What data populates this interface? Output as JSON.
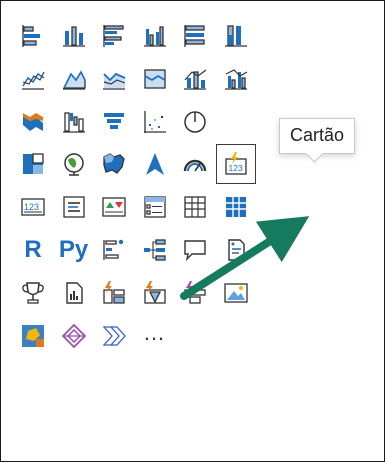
{
  "tooltip": {
    "text": "Cartão"
  },
  "text_icons": {
    "r": "R",
    "py": "Py",
    "more": "..."
  },
  "colors": {
    "blue": "#1f6fbf",
    "light_blue": "#8ab6e6",
    "yellow": "#f2b705",
    "orange": "#e07a1f",
    "purple": "#9b4fb0",
    "arrow": "#157a5e"
  },
  "visuals": [
    {
      "row": 0,
      "col": 0,
      "icon": "stacked-bar-chart-icon",
      "selected": false
    },
    {
      "row": 0,
      "col": 1,
      "icon": "stacked-column-chart-icon",
      "selected": false
    },
    {
      "row": 0,
      "col": 2,
      "icon": "clustered-bar-chart-icon",
      "selected": false
    },
    {
      "row": 0,
      "col": 3,
      "icon": "clustered-column-chart-icon",
      "selected": false
    },
    {
      "row": 0,
      "col": 4,
      "icon": "100-stacked-bar-chart-icon",
      "selected": false
    },
    {
      "row": 0,
      "col": 5,
      "icon": "100-stacked-column-chart-icon",
      "selected": false
    },
    {
      "row": 1,
      "col": 0,
      "icon": "line-chart-icon",
      "selected": false
    },
    {
      "row": 1,
      "col": 1,
      "icon": "area-chart-icon",
      "selected": false
    },
    {
      "row": 1,
      "col": 2,
      "icon": "stacked-area-chart-icon",
      "selected": false
    },
    {
      "row": 1,
      "col": 3,
      "icon": "100-stacked-area-chart-icon",
      "selected": false
    },
    {
      "row": 1,
      "col": 4,
      "icon": "line-and-column-chart-icon",
      "selected": false
    },
    {
      "row": 1,
      "col": 5,
      "icon": "line-and-clustered-column-chart-icon",
      "selected": false
    },
    {
      "row": 2,
      "col": 0,
      "icon": "ribbon-chart-icon",
      "selected": false
    },
    {
      "row": 2,
      "col": 1,
      "icon": "waterfall-chart-icon",
      "selected": false
    },
    {
      "row": 2,
      "col": 2,
      "icon": "funnel-chart-icon",
      "selected": false
    },
    {
      "row": 2,
      "col": 3,
      "icon": "scatter-chart-icon",
      "selected": false
    },
    {
      "row": 2,
      "col": 4,
      "icon": "pie-chart-icon",
      "selected": false
    },
    {
      "row": 3,
      "col": 0,
      "icon": "treemap-icon",
      "selected": false
    },
    {
      "row": 3,
      "col": 1,
      "icon": "globe-map-icon",
      "selected": false
    },
    {
      "row": 3,
      "col": 2,
      "icon": "filled-map-icon",
      "selected": false
    },
    {
      "row": 3,
      "col": 3,
      "icon": "azure-map-icon",
      "selected": false
    },
    {
      "row": 3,
      "col": 4,
      "icon": "gauge-icon",
      "selected": false
    },
    {
      "row": 3,
      "col": 5,
      "icon": "card-icon",
      "selected": true
    },
    {
      "row": 4,
      "col": 0,
      "icon": "multi-row-card-icon",
      "selected": false
    },
    {
      "row": 4,
      "col": 1,
      "icon": "kpi-list-icon",
      "selected": false
    },
    {
      "row": 4,
      "col": 2,
      "icon": "kpi-icon",
      "selected": false
    },
    {
      "row": 4,
      "col": 3,
      "icon": "slicer-icon",
      "selected": false
    },
    {
      "row": 4,
      "col": 4,
      "icon": "table-icon",
      "selected": false
    },
    {
      "row": 4,
      "col": 5,
      "icon": "matrix-icon",
      "selected": false
    },
    {
      "row": 5,
      "col": 0,
      "icon": "r-visual-icon",
      "selected": false
    },
    {
      "row": 5,
      "col": 1,
      "icon": "python-visual-icon",
      "selected": false
    },
    {
      "row": 5,
      "col": 2,
      "icon": "key-influencers-icon",
      "selected": false
    },
    {
      "row": 5,
      "col": 3,
      "icon": "decomposition-tree-icon",
      "selected": false
    },
    {
      "row": 5,
      "col": 4,
      "icon": "qa-icon",
      "selected": false
    },
    {
      "row": 5,
      "col": 5,
      "icon": "smart-narrative-icon",
      "selected": false
    },
    {
      "row": 6,
      "col": 0,
      "icon": "metrics-trophy-icon",
      "selected": false
    },
    {
      "row": 6,
      "col": 1,
      "icon": "paginated-report-icon",
      "selected": false
    },
    {
      "row": 6,
      "col": 2,
      "icon": "power-apps-icon",
      "selected": false
    },
    {
      "row": 6,
      "col": 3,
      "icon": "power-automate-icon",
      "selected": false
    },
    {
      "row": 6,
      "col": 4,
      "icon": "power-automate-alt-icon",
      "selected": false
    },
    {
      "row": 6,
      "col": 5,
      "icon": "image-icon",
      "selected": false
    },
    {
      "row": 7,
      "col": 0,
      "icon": "arcgis-map-icon",
      "selected": false
    },
    {
      "row": 7,
      "col": 1,
      "icon": "power-apps-diamond-icon",
      "selected": false
    },
    {
      "row": 7,
      "col": 2,
      "icon": "chevron-flow-icon",
      "selected": false
    },
    {
      "row": 7,
      "col": 3,
      "icon": "more-visuals-icon",
      "selected": false
    }
  ]
}
